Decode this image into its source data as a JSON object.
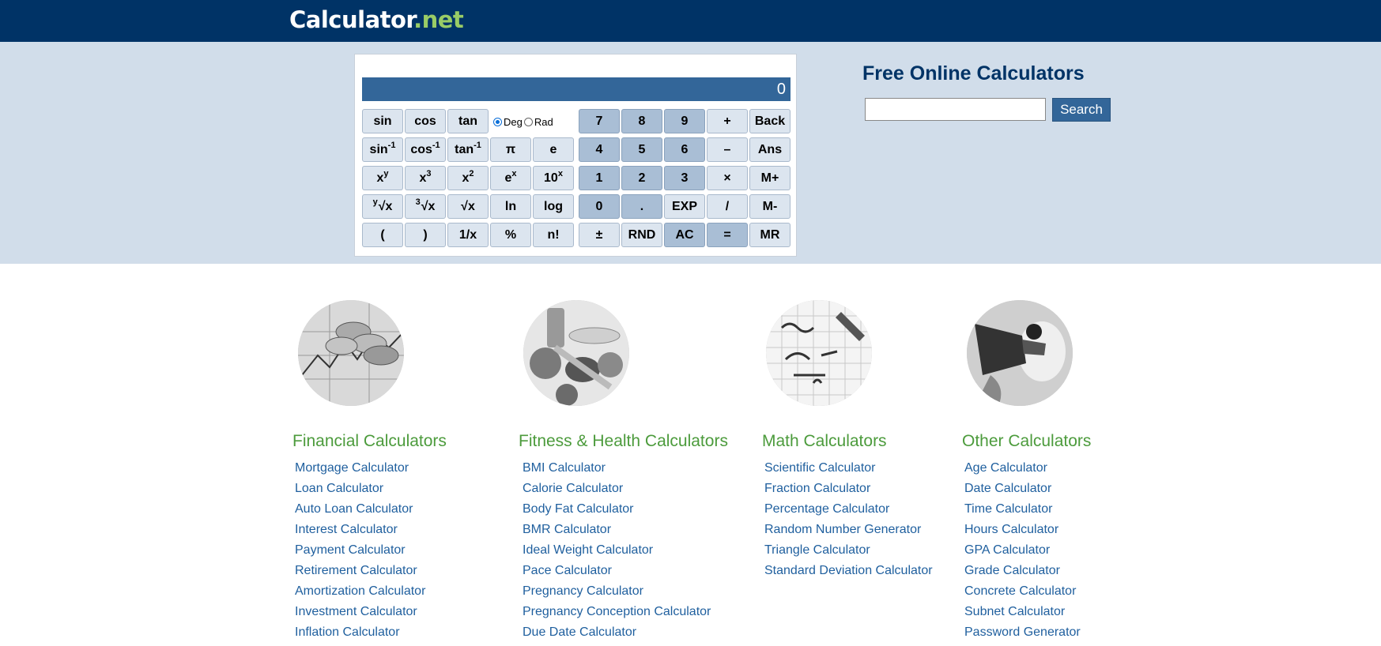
{
  "header": {
    "logo_main": "Calculator",
    "logo_suffix": ".net"
  },
  "calculator": {
    "display": "0",
    "deg_label": "Deg",
    "rad_label": "Rad",
    "angle_mode": "Deg",
    "keys": {
      "sin": "sin",
      "cos": "cos",
      "tan": "tan",
      "asin": "sin",
      "acos": "cos",
      "atan": "tan",
      "inv_exp": "-1",
      "pi": "π",
      "e": "e",
      "xy": "x",
      "xy_exp": "y",
      "x3": "x",
      "x3_exp": "3",
      "x2": "x",
      "x2_exp": "2",
      "ex": "e",
      "ex_exp": "x",
      "tenx": "10",
      "tenx_exp": "x",
      "yroot_pre": "y",
      "yroot": "√x",
      "root3_pre": "3",
      "root3": "√x",
      "sqrt": "√x",
      "ln": "ln",
      "log": "log",
      "lparen": "(",
      "rparen": ")",
      "recip": "1/x",
      "percent": "%",
      "fact": "n!",
      "n7": "7",
      "n8": "8",
      "n9": "9",
      "plus": "+",
      "back": "Back",
      "n4": "4",
      "n5": "5",
      "n6": "6",
      "minus": "–",
      "ans": "Ans",
      "n1": "1",
      "n2": "2",
      "n3": "3",
      "times": "×",
      "mplus": "M+",
      "n0": "0",
      "dot": ".",
      "exp": "EXP",
      "divide": "/",
      "mminus": "M-",
      "plusminus": "±",
      "rnd": "RND",
      "ac": "AC",
      "equals": "=",
      "mr": "MR"
    }
  },
  "sidebar": {
    "title": "Free Online Calculators",
    "search_value": "",
    "search_button": "Search"
  },
  "categories": [
    {
      "title": "Financial Calculators",
      "icon": "coins-chart-image",
      "links": [
        "Mortgage Calculator",
        "Loan Calculator",
        "Auto Loan Calculator",
        "Interest Calculator",
        "Payment Calculator",
        "Retirement Calculator",
        "Amortization Calculator",
        "Investment Calculator",
        "Inflation Calculator"
      ]
    },
    {
      "title": "Fitness & Health Calculators",
      "icon": "healthy-food-image",
      "links": [
        "BMI Calculator",
        "Calorie Calculator",
        "Body Fat Calculator",
        "BMR Calculator",
        "Ideal Weight Calculator",
        "Pace Calculator",
        "Pregnancy Calculator",
        "Pregnancy Conception Calculator",
        "Due Date Calculator"
      ]
    },
    {
      "title": "Math Calculators",
      "icon": "math-formula-image",
      "links": [
        "Scientific Calculator",
        "Fraction Calculator",
        "Percentage Calculator",
        "Random Number Generator",
        "Triangle Calculator",
        "Standard Deviation Calculator"
      ]
    },
    {
      "title": "Other Calculators",
      "icon": "fuel-pump-image",
      "links": [
        "Age Calculator",
        "Date Calculator",
        "Time Calculator",
        "Hours Calculator",
        "GPA Calculator",
        "Grade Calculator",
        "Concrete Calculator",
        "Subnet Calculator",
        "Password Generator"
      ]
    }
  ]
}
